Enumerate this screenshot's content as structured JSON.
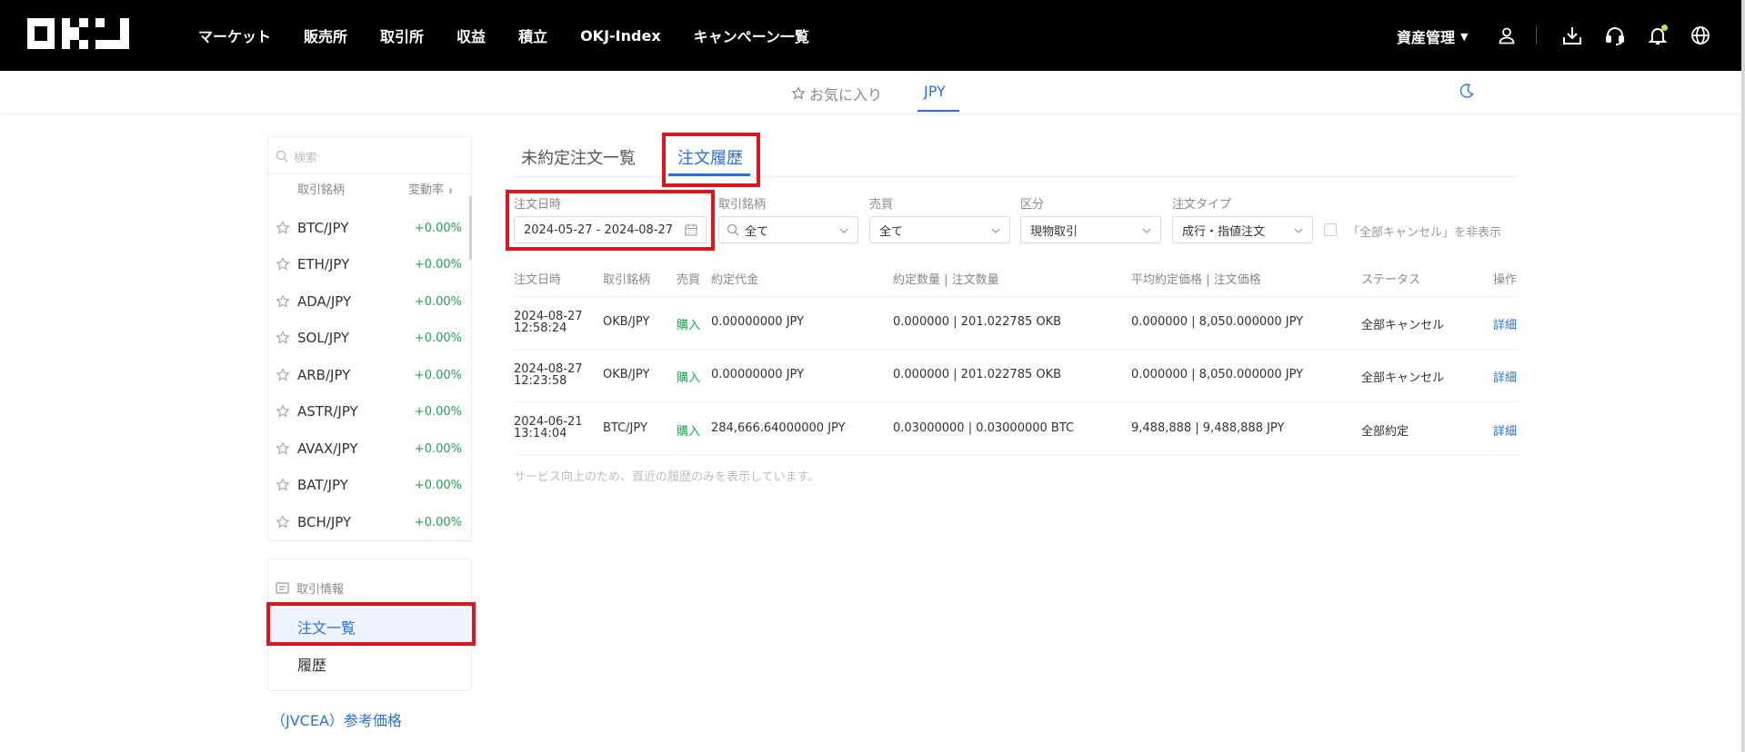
{
  "header": {
    "logo_text": "OKJ",
    "nav": [
      "マーケット",
      "販売所",
      "取引所",
      "収益",
      "積立",
      "OKJ-Index",
      "キャンペーン一覧"
    ],
    "asset_label": "資産管理"
  },
  "subbar": {
    "favorites_label": "お気に入り",
    "jpy_label": "JPY"
  },
  "sidebar": {
    "search_placeholder": "検索",
    "col_pair": "取引銘柄",
    "col_change": "変動率",
    "pairs": [
      {
        "symbol": "BTC/JPY",
        "change": "+0.00%"
      },
      {
        "symbol": "ETH/JPY",
        "change": "+0.00%"
      },
      {
        "symbol": "ADA/JPY",
        "change": "+0.00%"
      },
      {
        "symbol": "SOL/JPY",
        "change": "+0.00%"
      },
      {
        "symbol": "ARB/JPY",
        "change": "+0.00%"
      },
      {
        "symbol": "ASTR/JPY",
        "change": "+0.00%"
      },
      {
        "symbol": "AVAX/JPY",
        "change": "+0.00%"
      },
      {
        "symbol": "BAT/JPY",
        "change": "+0.00%"
      },
      {
        "symbol": "BCH/JPY",
        "change": "+0.00%"
      }
    ],
    "info_title": "取引情報",
    "orders_label": "注文一覧",
    "history_label": "履歴",
    "jvcea_label": "（JVCEA）参考価格"
  },
  "main": {
    "tab_open": "未約定注文一覧",
    "tab_history": "注文履歴",
    "filters": {
      "date_label": "注文日時",
      "date_value": "2024-05-27 - 2024-08-27",
      "pair_label": "取引銘柄",
      "pair_value": "全て",
      "side_label": "売買",
      "side_value": "全て",
      "category_label": "区分",
      "category_value": "現物取引",
      "type_label": "注文タイプ",
      "type_value": "成行・指値注文",
      "hide_cancel_label": "「全部キャンセル」を非表示"
    },
    "columns": [
      "注文日時",
      "取引銘柄",
      "売買",
      "約定代金",
      "約定数量 | 注文数量",
      "平均約定価格 | 注文価格",
      "ステータス",
      "操作"
    ],
    "rows": [
      {
        "date": "2024-08-27",
        "time": "12:58:24",
        "pair": "OKB/JPY",
        "side": "購入",
        "amount": "0.00000000 JPY",
        "qty": "0.000000 | 201.022785 OKB",
        "price": "0.000000 | 8,050.000000 JPY",
        "status": "全部キャンセル",
        "action": "詳細"
      },
      {
        "date": "2024-08-27",
        "time": "12:23:58",
        "pair": "OKB/JPY",
        "side": "購入",
        "amount": "0.00000000 JPY",
        "qty": "0.000000 | 201.022785 OKB",
        "price": "0.000000 | 8,050.000000 JPY",
        "status": "全部キャンセル",
        "action": "詳細"
      },
      {
        "date": "2024-06-21",
        "time": "13:14:04",
        "pair": "BTC/JPY",
        "side": "購入",
        "amount": "284,666.64000000 JPY",
        "qty": "0.03000000 | 0.03000000 BTC",
        "price": "9,488,888 | 9,488,888 JPY",
        "status": "全部約定",
        "action": "詳細"
      }
    ],
    "note": "サービス向上のため、直近の履歴のみを表示しています。"
  },
  "colors": {
    "accent": "#2a6fe5",
    "buy": "#1ca654",
    "highlight": "#e0141e"
  }
}
